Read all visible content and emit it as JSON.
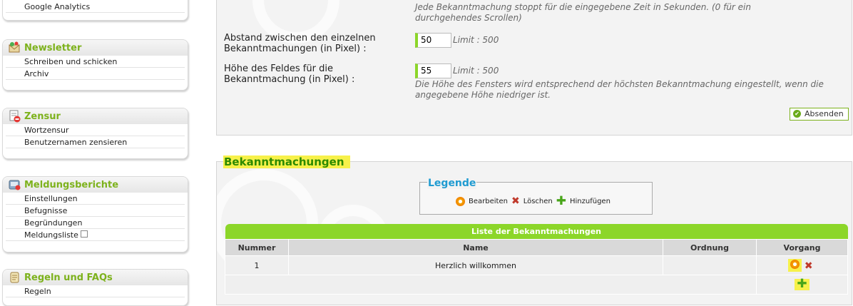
{
  "sidebar": {
    "top": {
      "items": [
        {
          "label": "Google Analytics"
        }
      ]
    },
    "newsletter": {
      "title": "Newsletter",
      "items": [
        {
          "label": "Schreiben und schicken"
        },
        {
          "label": "Archiv"
        }
      ]
    },
    "zensur": {
      "title": "Zensur",
      "items": [
        {
          "label": "Wortzensur"
        },
        {
          "label": "Benutzernamen zensieren"
        }
      ]
    },
    "meldungsberichte": {
      "title": "Meldungsberichte",
      "items": [
        {
          "label": "Einstellungen"
        },
        {
          "label": "Befugnisse"
        },
        {
          "label": "Begründungen"
        },
        {
          "label": "Meldungsliste"
        }
      ]
    },
    "regeln": {
      "title": "Regeln und FAQs",
      "items": [
        {
          "label": "Regeln"
        }
      ]
    }
  },
  "settings": {
    "stop_hint": "Jede Bekanntmachung stoppt für die eingegebene Zeit in Sekunden. (0 für ein durchgehendes Scrollen)",
    "spacing": {
      "label": "Abstand zwischen den einzelnen Bekanntmachungen (in Pixel) :",
      "value": "50",
      "limit": "Limit : 500"
    },
    "height": {
      "label": "Höhe des Feldes für die Bekanntmachung (in Pixel) :",
      "value": "55",
      "limit": "Limit : 500",
      "hint": "Die Höhe des Fensters wird entsprechend der höchsten Bekanntmachung eingestellt, wenn die angegebene Höhe niedriger ist."
    },
    "submit_label": "Absenden"
  },
  "announcements": {
    "title": "Bekanntmachungen",
    "legend": {
      "title": "Legende",
      "edit": "Bearbeiten",
      "delete": "Löschen",
      "add": "Hinzufügen"
    },
    "table": {
      "caption": "Liste der Bekanntmachungen",
      "headers": {
        "number": "Nummer",
        "name": "Name",
        "order": "Ordnung",
        "action": "Vorgang"
      },
      "rows": [
        {
          "number": "1",
          "name": "Herzlich willkommen",
          "order": ""
        }
      ]
    }
  },
  "colors": {
    "accent_green": "#8cd629",
    "sidebar_title": "#7db21c",
    "highlight": "#f7f14a",
    "legend_title": "#1f9bd1"
  }
}
